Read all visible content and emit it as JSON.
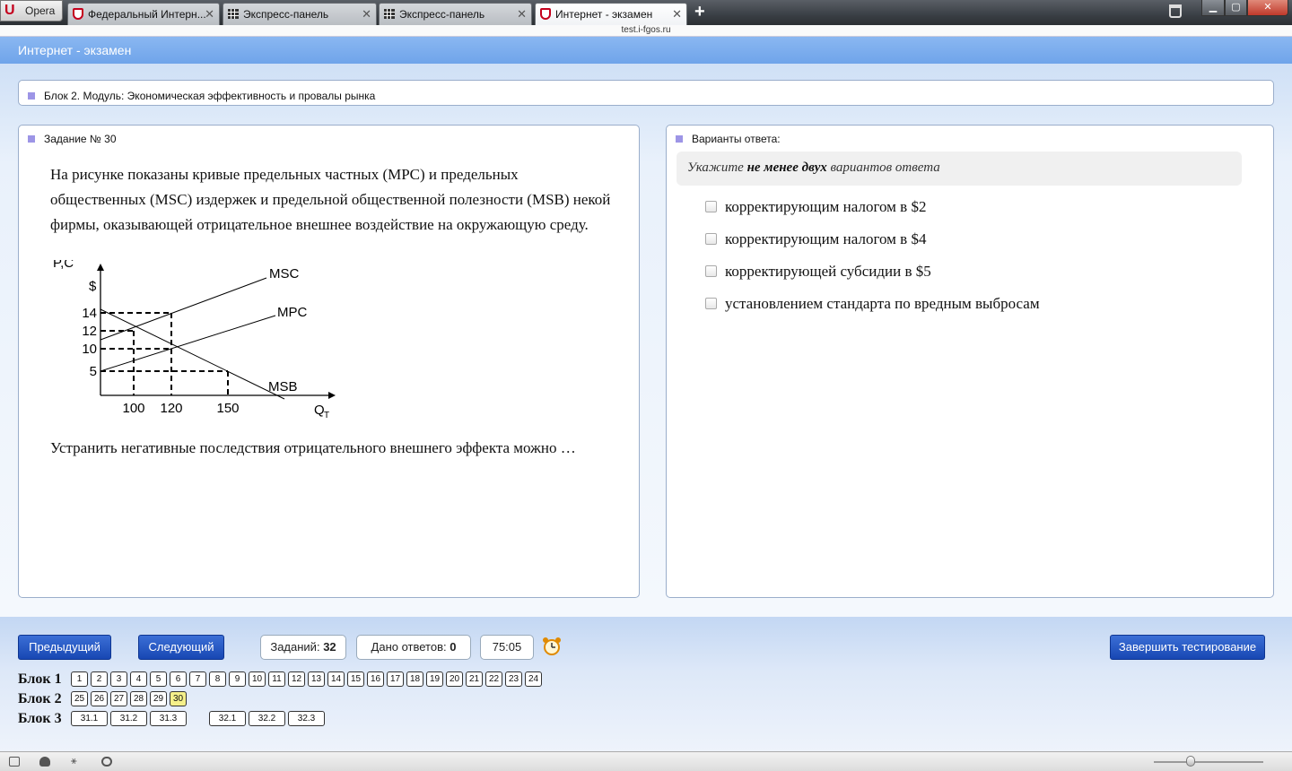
{
  "browser": {
    "menu_label": "Opera",
    "tabs": [
      {
        "title": "Федеральный Интерн..."
      },
      {
        "title": "Экспресс-панель"
      },
      {
        "title": "Экспресс-панель"
      },
      {
        "title": "Интернет - экзамен"
      }
    ],
    "new_tab": "+",
    "address": "test.i-fgos.ru"
  },
  "header": {
    "title": "Интернет - экзамен"
  },
  "module": {
    "title": "Блок 2. Модуль: Экономическая эффективность и провалы рынка"
  },
  "task": {
    "title": "Задание № 30",
    "text": "На рисунке показаны кривые предельных частных (MPC) и предельных общественных (MSC) издержек и предельной общественной полезности (MSB) некой фирмы, оказывающей отрицательное внешнее воздействие на окружающую среду.",
    "question": "Устранить негативные последствия отрицательного внешнего эффекта можно …"
  },
  "chart_data": {
    "type": "line",
    "ylabel": "P,C",
    "yunit": "$",
    "xlabel": "Q",
    "xlabel_sub": "T",
    "yticks": [
      "14",
      "12",
      "10",
      "5"
    ],
    "xticks": [
      "100",
      "120",
      "150"
    ],
    "series": [
      {
        "name": "MSC",
        "x": [
          0,
          120
        ],
        "y": [
          12,
          14
        ]
      },
      {
        "name": "MPC",
        "x": [
          0,
          120
        ],
        "y": [
          5,
          10
        ]
      },
      {
        "name": "MSB",
        "x": [
          0,
          100,
          120,
          150
        ],
        "y": [
          14,
          12,
          10,
          5
        ]
      }
    ]
  },
  "answers": {
    "title": "Варианты ответа:",
    "hint_pre": "Укажите ",
    "hint_bold": "не менее двух",
    "hint_post": " вариантов ответа",
    "options": [
      "корректирующим налогом в $2",
      "корректирующим налогом в $4",
      "корректирующей субсидии в $5",
      "установлением стандарта по вредным выбросам"
    ]
  },
  "controls": {
    "prev": "Предыдущий",
    "next": "Следующий",
    "tasks_label": "Заданий:",
    "tasks_count": "32",
    "answered_label": "Дано ответов:",
    "answered_count": "0",
    "timer": "75:05",
    "finish": "Завершить тестирование"
  },
  "blocks": [
    {
      "label": "Блок 1",
      "items": [
        "1",
        "2",
        "3",
        "4",
        "5",
        "6",
        "7",
        "8",
        "9",
        "10",
        "11",
        "12",
        "13",
        "14",
        "15",
        "16",
        "17",
        "18",
        "19",
        "20",
        "21",
        "22",
        "23",
        "24"
      ]
    },
    {
      "label": "Блок 2",
      "items": [
        "25",
        "26",
        "27",
        "28",
        "29",
        "30"
      ],
      "current": "30"
    },
    {
      "label": "Блок 3",
      "items": [
        "31.1",
        "31.2",
        "31.3",
        "32.1",
        "32.2",
        "32.3"
      ]
    }
  ],
  "colors": {
    "accent": "#1f4fbf",
    "header": "#7aacee",
    "current_question": "#f5f08a",
    "marker": "#9d95e6"
  }
}
